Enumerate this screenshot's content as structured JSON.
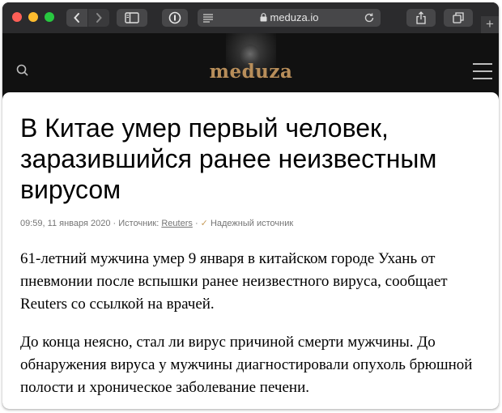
{
  "browser": {
    "url": "meduza.io",
    "new_tab_glyph": "+"
  },
  "site": {
    "logo_text": "meduza"
  },
  "article": {
    "headline": "В Китае умер первый человек, заразившийся ранее неизвестным вирусом",
    "meta": {
      "datetime": "09:59, 11 января 2020",
      "separator": "·",
      "source_label": "Источник:",
      "source_name": "Reuters",
      "check_glyph": "✓",
      "trust_label": "Надежный источник"
    },
    "paragraphs": [
      "61-летний мужчина умер 9 января в китайском городе Ухань от пневмонии после вспышки ранее неизвестного вируса, сообщает Reuters со ссылкой на врачей.",
      "До конца неясно, стал ли вирус причиной смерти мужчины. До обнаружения вируса у мужчины диагностировали опухоль брюшной полости и хроническое заболевание печени."
    ]
  },
  "colors": {
    "toolbar_bg": "#2b2b2d",
    "site_header_bg": "#111111",
    "logo": "#b88e5a",
    "meta_text": "#757575",
    "check": "#c79b5a"
  },
  "icons": {
    "back": "chevron-left-icon",
    "forward": "chevron-right-icon",
    "sidebar": "sidebar-icon",
    "password_manager": "onepassword-icon",
    "reader": "reader-icon",
    "lock": "lock-icon",
    "reload": "reload-icon",
    "share": "share-icon",
    "tabs": "tabs-icon",
    "search": "search-icon",
    "menu": "hamburger-menu-icon"
  }
}
